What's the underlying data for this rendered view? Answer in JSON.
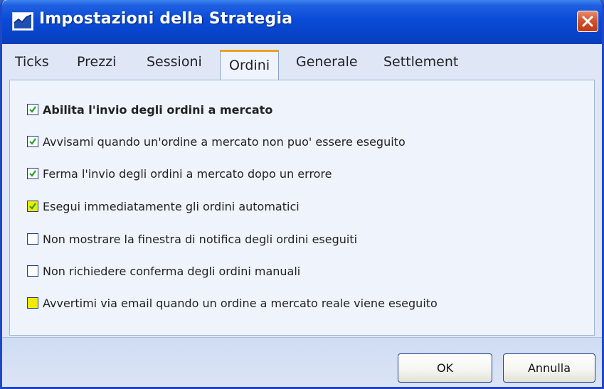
{
  "window": {
    "title": "Impostazioni della Strategia",
    "icon": "chart-icon",
    "close_icon": "close-icon"
  },
  "tabs": [
    {
      "label": "Ticks",
      "active": false
    },
    {
      "label": "Prezzi",
      "active": false
    },
    {
      "label": "Sessioni",
      "active": false
    },
    {
      "label": "Ordini",
      "active": true
    },
    {
      "label": "Generale",
      "active": false
    },
    {
      "label": "Settlement",
      "active": false
    }
  ],
  "options": [
    {
      "label": "Abilita l'invio degli ordini a mercato",
      "checked": true,
      "bold": true
    },
    {
      "label": "Avvisami quando un'ordine a mercato non puo' essere eseguito",
      "checked": true
    },
    {
      "label": "Ferma l'invio degli ordini a mercato dopo un errore",
      "checked": true
    },
    {
      "label": "Esegui immediatamente gli ordini automatici",
      "checked": true,
      "highlight": "#f2ea00"
    },
    {
      "label": "Non mostrare la finestra di notifica degli ordini eseguiti",
      "checked": false
    },
    {
      "label": "Non richiedere conferma degli ordini manuali",
      "checked": false
    },
    {
      "label": "Avvertimi via email quando un ordine a mercato reale viene eseguito",
      "checked": false,
      "highlight": "#f2ea00"
    }
  ],
  "buttons": {
    "ok": "OK",
    "cancel": "Annulla"
  },
  "colors": {
    "titlebar": "#0a4ad8",
    "active_tab_accent": "#f0a020",
    "close_button": "#d0502c",
    "check": "#21a121"
  }
}
